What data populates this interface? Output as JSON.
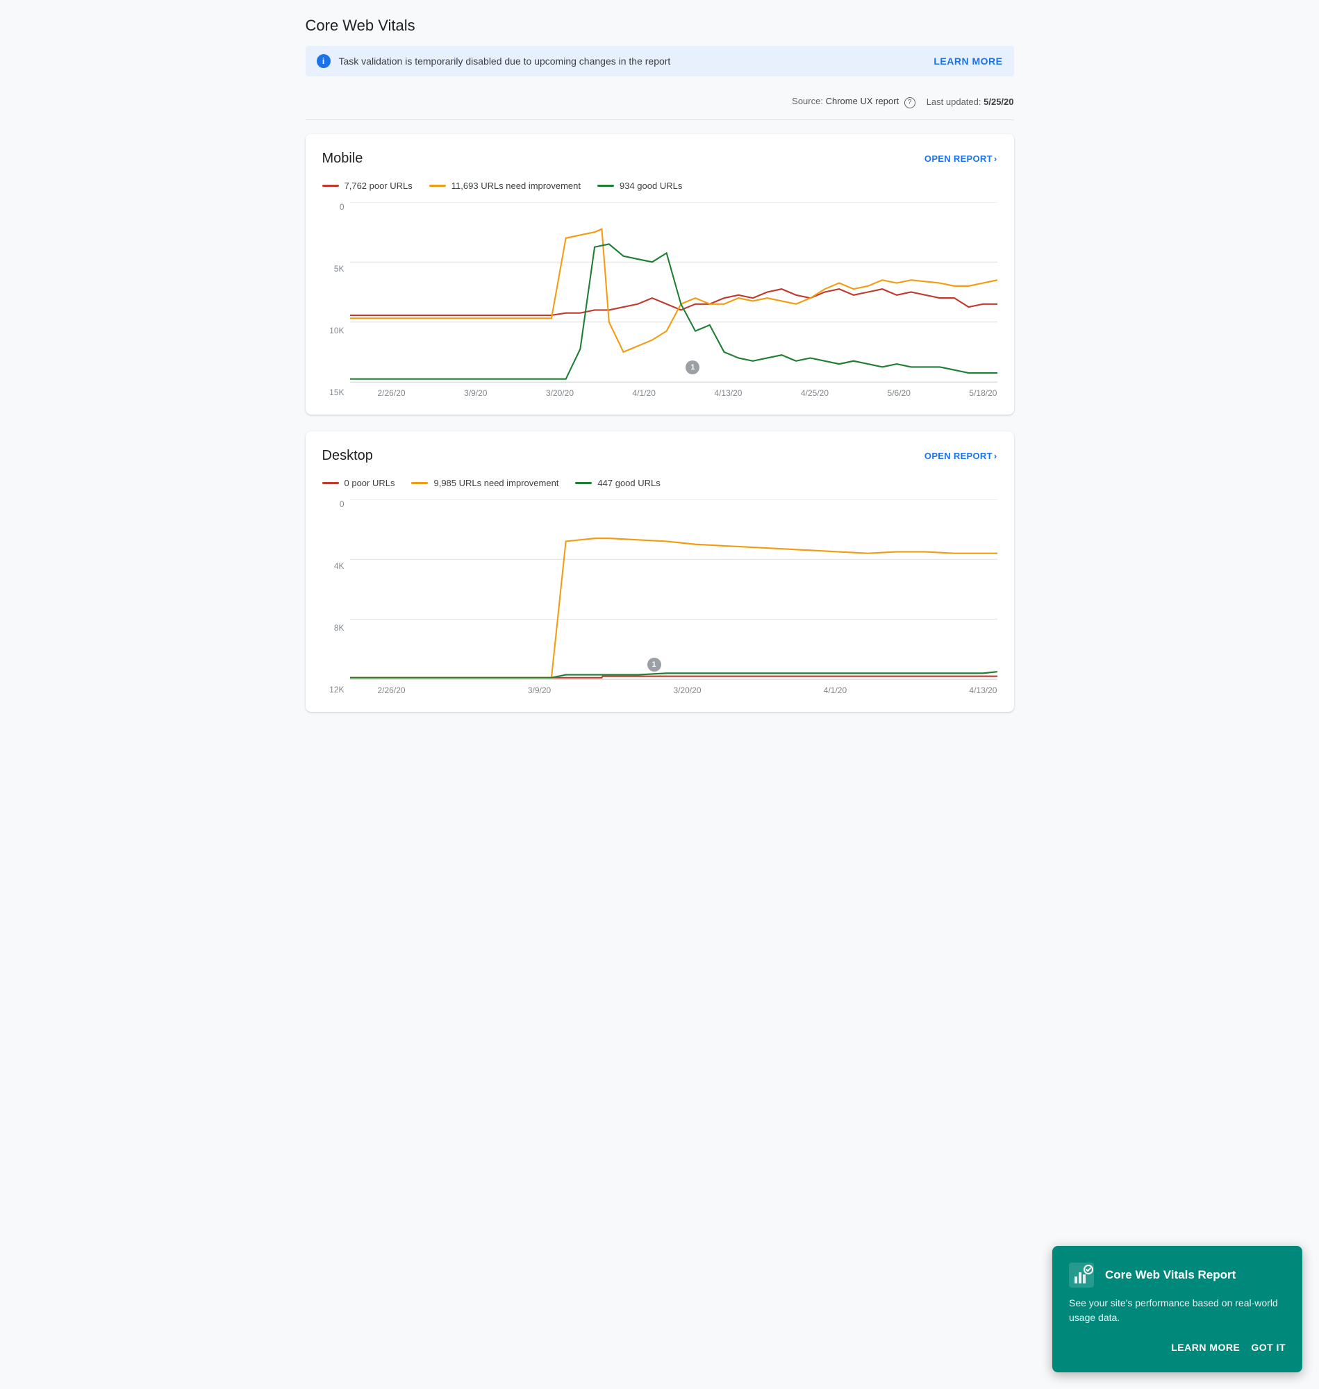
{
  "page": {
    "title": "Core Web Vitals"
  },
  "banner": {
    "text": "Task validation is temporarily disabled due to upcoming changes in the report",
    "link_label": "LEARN MORE"
  },
  "source_bar": {
    "source_label": "Source:",
    "source_value": "Chrome UX report",
    "last_updated_label": "Last updated:",
    "last_updated_value": "5/25/20"
  },
  "mobile_card": {
    "title": "Mobile",
    "open_report_label": "OPEN REPORT",
    "legend": [
      {
        "label": "7,762 poor URLs",
        "color": "#c0392b"
      },
      {
        "label": "11,693 URLs need improvement",
        "color": "#f39c12"
      },
      {
        "label": "934 good URLs",
        "color": "#1e7e34"
      }
    ],
    "y_labels": [
      "0",
      "5K",
      "10K",
      "15K"
    ],
    "x_labels": [
      "2/26/20",
      "3/9/20",
      "3/20/20",
      "4/1/20",
      "4/13/20",
      "4/25/20",
      "5/6/20",
      "5/18/20"
    ]
  },
  "desktop_card": {
    "title": "Desktop",
    "open_report_label": "OPEN REPORT",
    "legend": [
      {
        "label": "0 poor URLs",
        "color": "#c0392b"
      },
      {
        "label": "9,985 URLs need improvement",
        "color": "#f39c12"
      },
      {
        "label": "447 good URLs",
        "color": "#1e7e34"
      }
    ],
    "y_labels": [
      "0",
      "4K",
      "8K",
      "12K"
    ],
    "x_labels": [
      "2/26/20",
      "3/9/20",
      "3/20/20",
      "4/1/20",
      "4/13/20"
    ]
  },
  "popup": {
    "title": "Core Web Vitals Report",
    "body": "See your site's performance based on real-world usage data.",
    "learn_more_label": "LEARN MORE",
    "got_it_label": "GOT IT",
    "icon": "chart-icon"
  }
}
